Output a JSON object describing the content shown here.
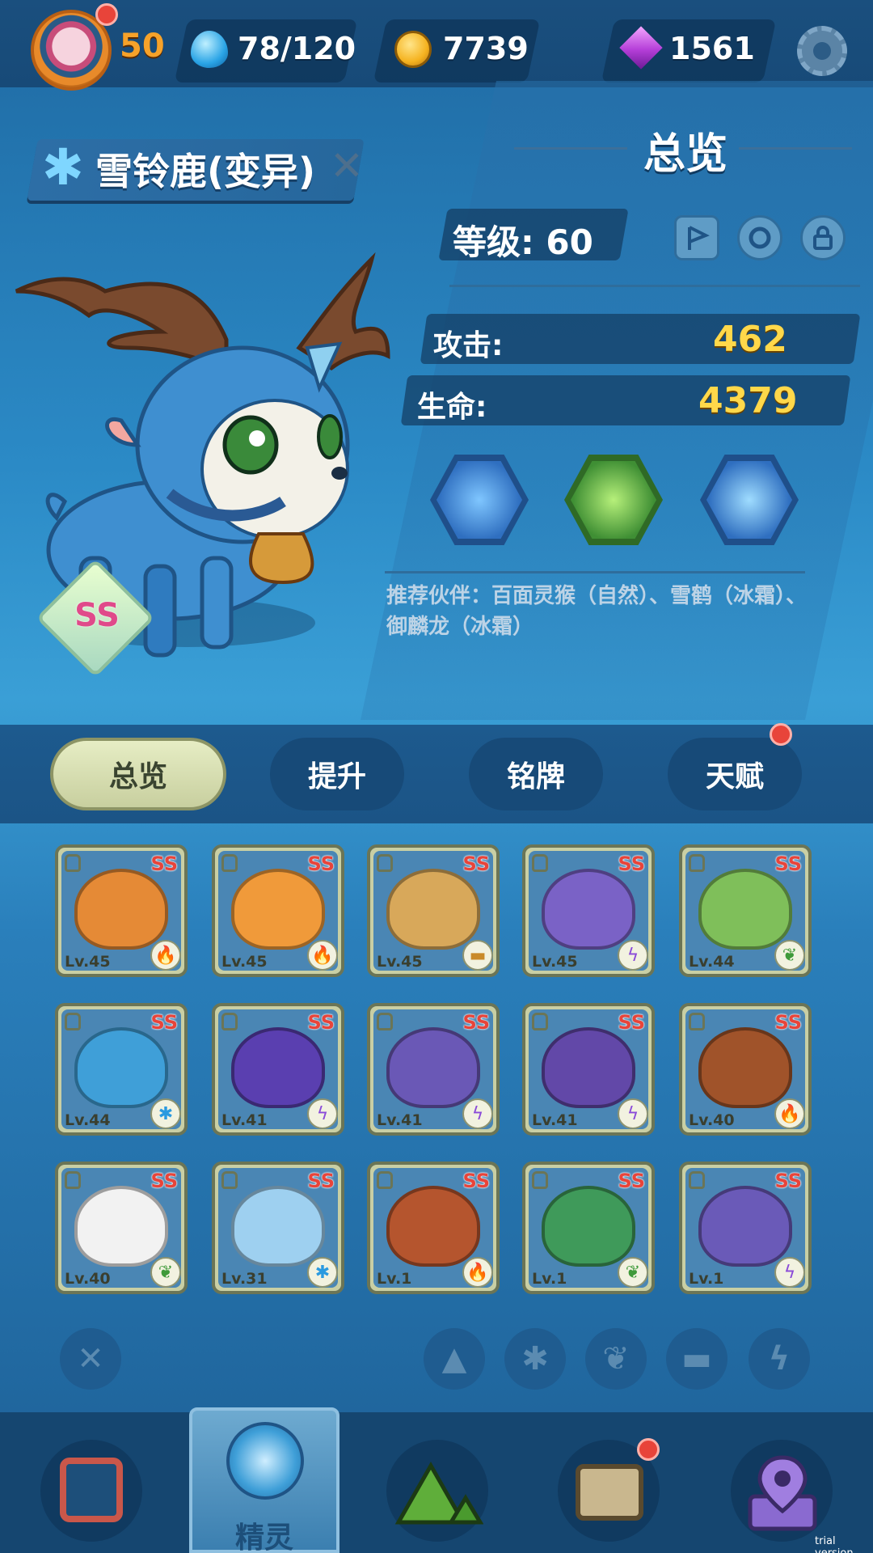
{
  "header": {
    "player_level": "50",
    "energy": "78/120",
    "coins": "7739",
    "gems": "1561"
  },
  "pet": {
    "name": "雪铃鹿(变异)",
    "rank": "SS"
  },
  "overview": {
    "title": "总览",
    "level_label": "等级: 60",
    "attack_label": "攻击:",
    "attack_value": "462",
    "hp_label": "生命:",
    "hp_value": "4379",
    "recommend": "推荐伙伴：百面灵猴（自然）、雪鹤（冰霜）、御麟龙（冰霜）"
  },
  "tabs": [
    {
      "label": "总览"
    },
    {
      "label": "提升"
    },
    {
      "label": "铭牌"
    },
    {
      "label": "天赋"
    }
  ],
  "cards": [
    {
      "lv": "Lv.45",
      "rank": "SS",
      "element": "fire",
      "color": "#e58a36"
    },
    {
      "lv": "Lv.45",
      "rank": "SS",
      "element": "fire",
      "color": "#f09a3a"
    },
    {
      "lv": "Lv.45",
      "rank": "SS",
      "element": "earth",
      "color": "#d8a85a"
    },
    {
      "lv": "Lv.45",
      "rank": "SS",
      "element": "thunder",
      "color": "#7a62c6"
    },
    {
      "lv": "Lv.44",
      "rank": "SS",
      "element": "nature",
      "color": "#7fbf5a"
    },
    {
      "lv": "Lv.44",
      "rank": "SS",
      "element": "ice",
      "color": "#3f9fd8"
    },
    {
      "lv": "Lv.41",
      "rank": "SS",
      "element": "thunder",
      "color": "#5a3fb0"
    },
    {
      "lv": "Lv.41",
      "rank": "SS",
      "element": "thunder",
      "color": "#6a58b6"
    },
    {
      "lv": "Lv.41",
      "rank": "SS",
      "element": "thunder",
      "color": "#6248a8"
    },
    {
      "lv": "Lv.40",
      "rank": "SS",
      "element": "fire",
      "color": "#a0532a"
    },
    {
      "lv": "Lv.40",
      "rank": "SS",
      "element": "nature",
      "color": "#f2f2f2"
    },
    {
      "lv": "Lv.31",
      "rank": "SS",
      "element": "ice",
      "color": "#9ed0f0"
    },
    {
      "lv": "Lv.1",
      "rank": "SS",
      "element": "fire",
      "color": "#b5552e"
    },
    {
      "lv": "Lv.1",
      "rank": "SS",
      "element": "nature",
      "color": "#3f9a5a"
    },
    {
      "lv": "Lv.1",
      "rank": "SS",
      "element": "thunder",
      "color": "#6a5ab8"
    }
  ],
  "bottom_nav": {
    "active_label": "精灵"
  },
  "watermark": "trial version",
  "colors": {
    "accent_yellow": "#ffd84a",
    "badge_red": "#e8443a",
    "tab_active": "#e6edc4"
  }
}
